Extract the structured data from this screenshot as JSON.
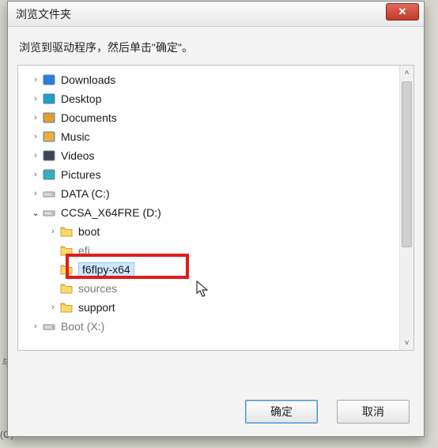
{
  "dialog": {
    "title": "浏览文件夹",
    "instruction": "浏览到驱动程序，然后单击\"确定\"。",
    "close_glyph": "✕"
  },
  "tree": {
    "items": [
      {
        "depth": 1,
        "expander": "closed",
        "icon": "lib-down",
        "label": "Downloads"
      },
      {
        "depth": 1,
        "expander": "closed",
        "icon": "lib-desk",
        "label": "Desktop"
      },
      {
        "depth": 1,
        "expander": "closed",
        "icon": "lib-doc",
        "label": "Documents"
      },
      {
        "depth": 1,
        "expander": "closed",
        "icon": "lib-music",
        "label": "Music"
      },
      {
        "depth": 1,
        "expander": "closed",
        "icon": "lib-video",
        "label": "Videos"
      },
      {
        "depth": 1,
        "expander": "closed",
        "icon": "lib-pic",
        "label": "Pictures"
      },
      {
        "depth": 1,
        "expander": "closed",
        "icon": "drive",
        "label": "DATA (C:)"
      },
      {
        "depth": 1,
        "expander": "open",
        "icon": "drive",
        "label": "CCSA_X64FRE (D:)"
      },
      {
        "depth": 2,
        "expander": "closed",
        "icon": "folder",
        "label": "boot"
      },
      {
        "depth": 2,
        "expander": "none",
        "icon": "folder",
        "label": "efi",
        "cutoff_top": true
      },
      {
        "depth": 2,
        "expander": "none",
        "icon": "folder",
        "label": "f6flpy-x64",
        "selected": true
      },
      {
        "depth": 2,
        "expander": "none",
        "icon": "folder",
        "label": "sources",
        "cutoff_top": true
      },
      {
        "depth": 2,
        "expander": "closed",
        "icon": "folder",
        "label": "support"
      },
      {
        "depth": 1,
        "expander": "closed",
        "icon": "drive",
        "label": "Boot (X:)",
        "cutoff_bottom": true
      }
    ]
  },
  "buttons": {
    "ok": "确定",
    "cancel": "取消"
  },
  "background": {
    "frag1": "(O)",
    "frag2": "与"
  },
  "icons": {
    "chevron_closed": "›",
    "chevron_open": "⌄",
    "scroll_up": "˄",
    "scroll_down": "˅"
  }
}
